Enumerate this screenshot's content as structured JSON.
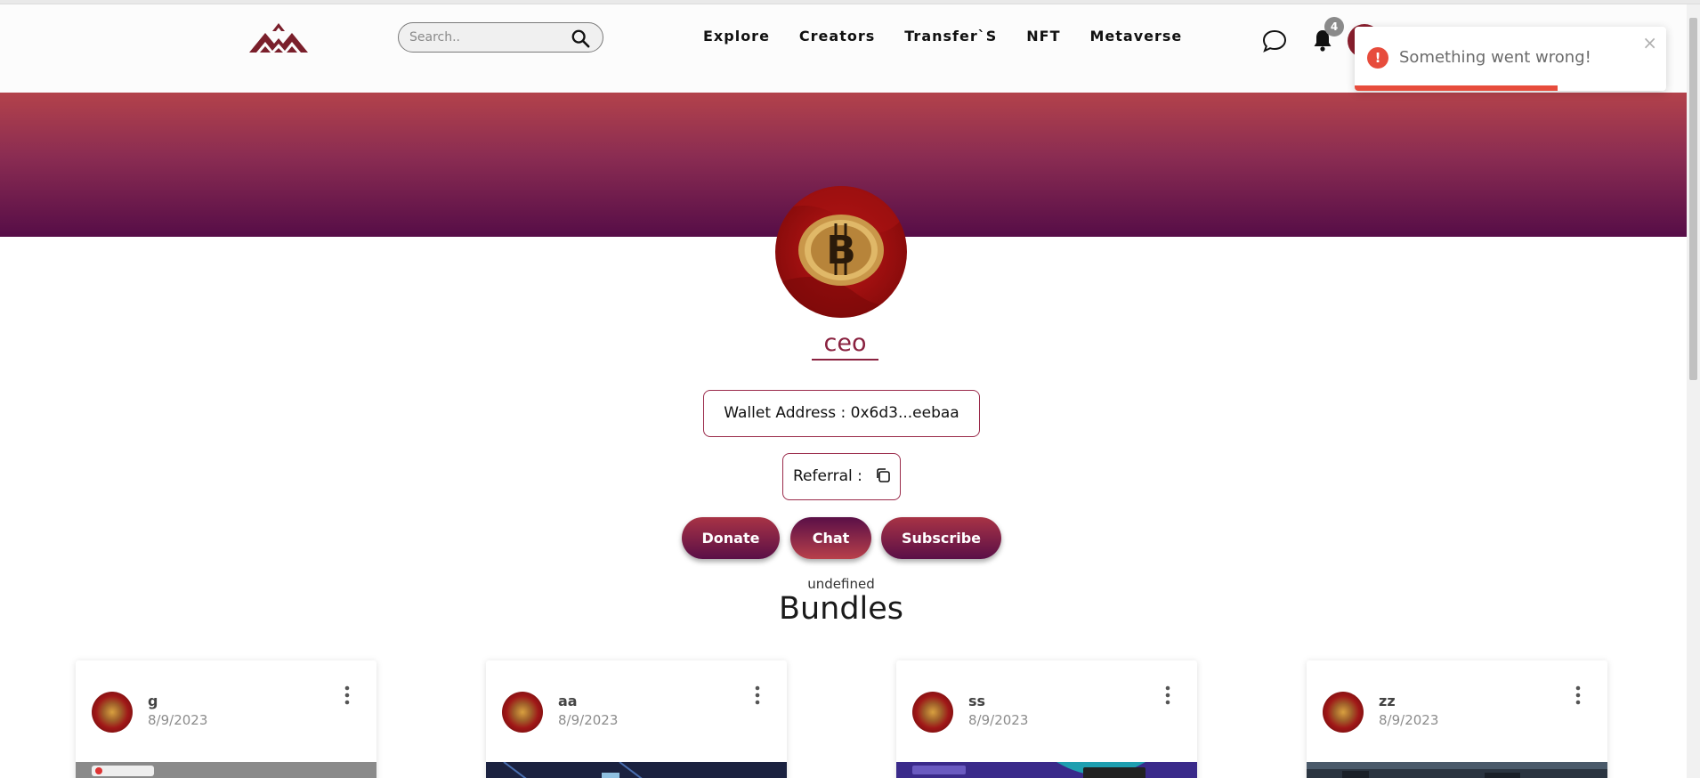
{
  "navbar": {
    "search_placeholder": "Search..",
    "links": [
      "Explore",
      "Creators",
      "Transfer`S",
      "NFT",
      "Metaverse"
    ],
    "notification_count": "4"
  },
  "toast": {
    "message": "Something went wrong!",
    "icon": "!",
    "close": "×",
    "progress": 0.65,
    "type": "error"
  },
  "profile": {
    "username": "ceo",
    "wallet_label": "Wallet Address : 0x6d3...eebaa",
    "referral_label": "Referral :",
    "buttons": {
      "donate": "Donate",
      "chat": "Chat",
      "subscribe": "Subscribe"
    },
    "undefined_text": "undefined"
  },
  "bundles": {
    "title": "Bundles",
    "cards": [
      {
        "name": "g",
        "date": "8/9/2023"
      },
      {
        "name": "aa",
        "date": "8/9/2023"
      },
      {
        "name": "ss",
        "date": "8/9/2023"
      },
      {
        "name": "zz",
        "date": "8/9/2023"
      }
    ]
  },
  "colors": {
    "brand": "#8a2240",
    "banner_top": "#b3424b",
    "banner_bottom": "#560d47",
    "error": "#e74c3c"
  }
}
